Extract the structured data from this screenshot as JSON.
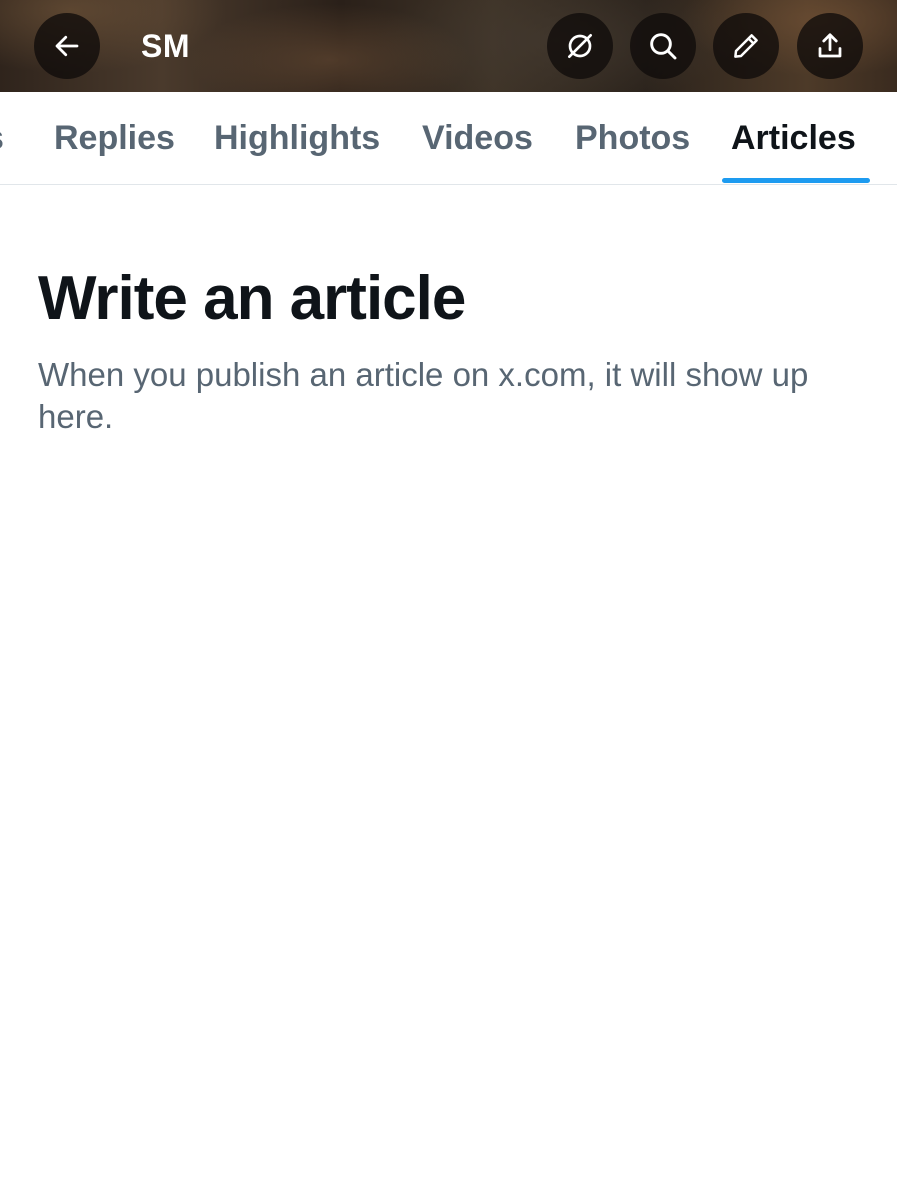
{
  "header": {
    "title": "SM",
    "icons": [
      "back-arrow-icon",
      "grok-icon",
      "search-icon",
      "compose-icon",
      "share-icon"
    ]
  },
  "tabs": [
    {
      "label": "s",
      "active": false
    },
    {
      "label": "Replies",
      "active": false
    },
    {
      "label": "Highlights",
      "active": false
    },
    {
      "label": "Videos",
      "active": false
    },
    {
      "label": "Photos",
      "active": false
    },
    {
      "label": "Articles",
      "active": true
    }
  ],
  "empty_state": {
    "heading": "Write an article",
    "description": "When you publish an article on x.com, it will show up here."
  },
  "colors": {
    "accent": "#1d9bf0",
    "text_primary": "#0f1419",
    "text_secondary": "#586673"
  }
}
